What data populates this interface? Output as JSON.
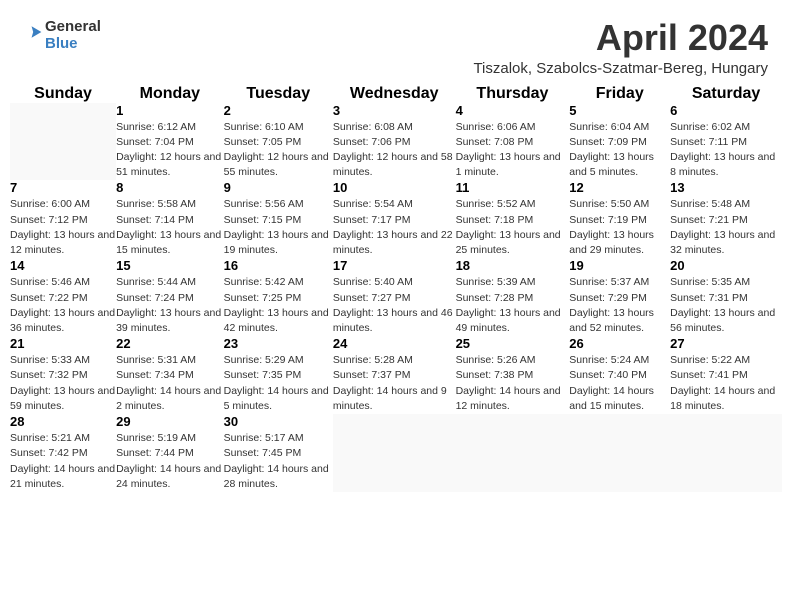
{
  "header": {
    "month_title": "April 2024",
    "location": "Tiszalok, Szabolcs-Szatmar-Bereg, Hungary",
    "logo_line1": "General",
    "logo_line2": "Blue"
  },
  "weekdays": [
    "Sunday",
    "Monday",
    "Tuesday",
    "Wednesday",
    "Thursday",
    "Friday",
    "Saturday"
  ],
  "weeks": [
    [
      {
        "day": "",
        "sunrise": "",
        "sunset": "",
        "daylight": ""
      },
      {
        "day": "1",
        "sunrise": "Sunrise: 6:12 AM",
        "sunset": "Sunset: 7:04 PM",
        "daylight": "Daylight: 12 hours and 51 minutes."
      },
      {
        "day": "2",
        "sunrise": "Sunrise: 6:10 AM",
        "sunset": "Sunset: 7:05 PM",
        "daylight": "Daylight: 12 hours and 55 minutes."
      },
      {
        "day": "3",
        "sunrise": "Sunrise: 6:08 AM",
        "sunset": "Sunset: 7:06 PM",
        "daylight": "Daylight: 12 hours and 58 minutes."
      },
      {
        "day": "4",
        "sunrise": "Sunrise: 6:06 AM",
        "sunset": "Sunset: 7:08 PM",
        "daylight": "Daylight: 13 hours and 1 minute."
      },
      {
        "day": "5",
        "sunrise": "Sunrise: 6:04 AM",
        "sunset": "Sunset: 7:09 PM",
        "daylight": "Daylight: 13 hours and 5 minutes."
      },
      {
        "day": "6",
        "sunrise": "Sunrise: 6:02 AM",
        "sunset": "Sunset: 7:11 PM",
        "daylight": "Daylight: 13 hours and 8 minutes."
      }
    ],
    [
      {
        "day": "7",
        "sunrise": "Sunrise: 6:00 AM",
        "sunset": "Sunset: 7:12 PM",
        "daylight": "Daylight: 13 hours and 12 minutes."
      },
      {
        "day": "8",
        "sunrise": "Sunrise: 5:58 AM",
        "sunset": "Sunset: 7:14 PM",
        "daylight": "Daylight: 13 hours and 15 minutes."
      },
      {
        "day": "9",
        "sunrise": "Sunrise: 5:56 AM",
        "sunset": "Sunset: 7:15 PM",
        "daylight": "Daylight: 13 hours and 19 minutes."
      },
      {
        "day": "10",
        "sunrise": "Sunrise: 5:54 AM",
        "sunset": "Sunset: 7:17 PM",
        "daylight": "Daylight: 13 hours and 22 minutes."
      },
      {
        "day": "11",
        "sunrise": "Sunrise: 5:52 AM",
        "sunset": "Sunset: 7:18 PM",
        "daylight": "Daylight: 13 hours and 25 minutes."
      },
      {
        "day": "12",
        "sunrise": "Sunrise: 5:50 AM",
        "sunset": "Sunset: 7:19 PM",
        "daylight": "Daylight: 13 hours and 29 minutes."
      },
      {
        "day": "13",
        "sunrise": "Sunrise: 5:48 AM",
        "sunset": "Sunset: 7:21 PM",
        "daylight": "Daylight: 13 hours and 32 minutes."
      }
    ],
    [
      {
        "day": "14",
        "sunrise": "Sunrise: 5:46 AM",
        "sunset": "Sunset: 7:22 PM",
        "daylight": "Daylight: 13 hours and 36 minutes."
      },
      {
        "day": "15",
        "sunrise": "Sunrise: 5:44 AM",
        "sunset": "Sunset: 7:24 PM",
        "daylight": "Daylight: 13 hours and 39 minutes."
      },
      {
        "day": "16",
        "sunrise": "Sunrise: 5:42 AM",
        "sunset": "Sunset: 7:25 PM",
        "daylight": "Daylight: 13 hours and 42 minutes."
      },
      {
        "day": "17",
        "sunrise": "Sunrise: 5:40 AM",
        "sunset": "Sunset: 7:27 PM",
        "daylight": "Daylight: 13 hours and 46 minutes."
      },
      {
        "day": "18",
        "sunrise": "Sunrise: 5:39 AM",
        "sunset": "Sunset: 7:28 PM",
        "daylight": "Daylight: 13 hours and 49 minutes."
      },
      {
        "day": "19",
        "sunrise": "Sunrise: 5:37 AM",
        "sunset": "Sunset: 7:29 PM",
        "daylight": "Daylight: 13 hours and 52 minutes."
      },
      {
        "day": "20",
        "sunrise": "Sunrise: 5:35 AM",
        "sunset": "Sunset: 7:31 PM",
        "daylight": "Daylight: 13 hours and 56 minutes."
      }
    ],
    [
      {
        "day": "21",
        "sunrise": "Sunrise: 5:33 AM",
        "sunset": "Sunset: 7:32 PM",
        "daylight": "Daylight: 13 hours and 59 minutes."
      },
      {
        "day": "22",
        "sunrise": "Sunrise: 5:31 AM",
        "sunset": "Sunset: 7:34 PM",
        "daylight": "Daylight: 14 hours and 2 minutes."
      },
      {
        "day": "23",
        "sunrise": "Sunrise: 5:29 AM",
        "sunset": "Sunset: 7:35 PM",
        "daylight": "Daylight: 14 hours and 5 minutes."
      },
      {
        "day": "24",
        "sunrise": "Sunrise: 5:28 AM",
        "sunset": "Sunset: 7:37 PM",
        "daylight": "Daylight: 14 hours and 9 minutes."
      },
      {
        "day": "25",
        "sunrise": "Sunrise: 5:26 AM",
        "sunset": "Sunset: 7:38 PM",
        "daylight": "Daylight: 14 hours and 12 minutes."
      },
      {
        "day": "26",
        "sunrise": "Sunrise: 5:24 AM",
        "sunset": "Sunset: 7:40 PM",
        "daylight": "Daylight: 14 hours and 15 minutes."
      },
      {
        "day": "27",
        "sunrise": "Sunrise: 5:22 AM",
        "sunset": "Sunset: 7:41 PM",
        "daylight": "Daylight: 14 hours and 18 minutes."
      }
    ],
    [
      {
        "day": "28",
        "sunrise": "Sunrise: 5:21 AM",
        "sunset": "Sunset: 7:42 PM",
        "daylight": "Daylight: 14 hours and 21 minutes."
      },
      {
        "day": "29",
        "sunrise": "Sunrise: 5:19 AM",
        "sunset": "Sunset: 7:44 PM",
        "daylight": "Daylight: 14 hours and 24 minutes."
      },
      {
        "day": "30",
        "sunrise": "Sunrise: 5:17 AM",
        "sunset": "Sunset: 7:45 PM",
        "daylight": "Daylight: 14 hours and 28 minutes."
      },
      {
        "day": "",
        "sunrise": "",
        "sunset": "",
        "daylight": ""
      },
      {
        "day": "",
        "sunrise": "",
        "sunset": "",
        "daylight": ""
      },
      {
        "day": "",
        "sunrise": "",
        "sunset": "",
        "daylight": ""
      },
      {
        "day": "",
        "sunrise": "",
        "sunset": "",
        "daylight": ""
      }
    ]
  ]
}
